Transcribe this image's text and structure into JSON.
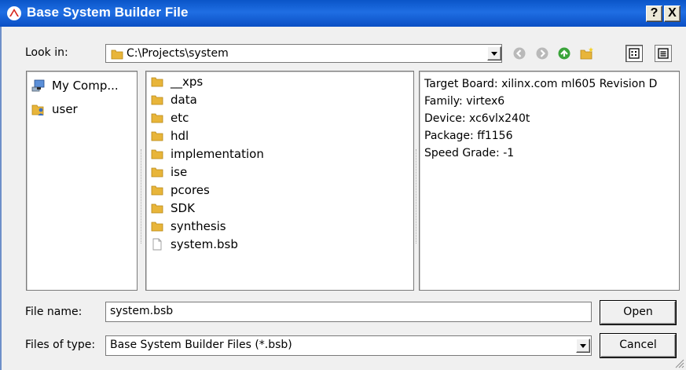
{
  "window": {
    "title": "Base System Builder File"
  },
  "title_buttons": {
    "help": "?",
    "close": "X"
  },
  "look_in": {
    "label": "Look in:",
    "path": "C:\\Projects\\system"
  },
  "places": [
    {
      "label": "My Comp...",
      "icon": "computer-icon"
    },
    {
      "label": "user",
      "icon": "user-folder-icon"
    }
  ],
  "files": [
    {
      "name": "__xps",
      "type": "folder"
    },
    {
      "name": "data",
      "type": "folder"
    },
    {
      "name": "etc",
      "type": "folder"
    },
    {
      "name": "hdl",
      "type": "folder"
    },
    {
      "name": "implementation",
      "type": "folder"
    },
    {
      "name": "ise",
      "type": "folder"
    },
    {
      "name": "pcores",
      "type": "folder"
    },
    {
      "name": "SDK",
      "type": "folder"
    },
    {
      "name": "synthesis",
      "type": "folder"
    },
    {
      "name": "system.bsb",
      "type": "file"
    }
  ],
  "info": {
    "target_board": "Target Board: xilinx.com ml605 Revision D",
    "family": "Family: virtex6",
    "device": "Device: xc6vlx240t",
    "package": "Package: ff1156",
    "speed_grade": "Speed Grade: -1"
  },
  "file_name": {
    "label": "File name:",
    "value": "system.bsb"
  },
  "file_type": {
    "label": "Files of type:",
    "value": "Base System Builder Files (*.bsb)"
  },
  "buttons": {
    "open": "Open",
    "cancel": "Cancel"
  },
  "colors": {
    "title_bar": "#0a55c8",
    "dialog_bg": "#f0f0f0",
    "folder": "#e8b53a",
    "nav_green": "#3aa43a"
  }
}
